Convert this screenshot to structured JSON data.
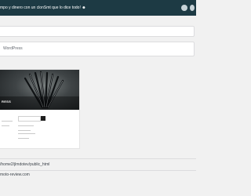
{
  "promo": {
    "text": "mpo y dinero con un clonSmt que lo dice todo! ☻",
    "icons": [
      "user-icon",
      "gear-icon"
    ]
  },
  "installation": {
    "software": "WordPress",
    "theme_preview_title": "RESS",
    "path": "/home2/jlmdotev/public_html",
    "domain": "moto-review.com"
  }
}
